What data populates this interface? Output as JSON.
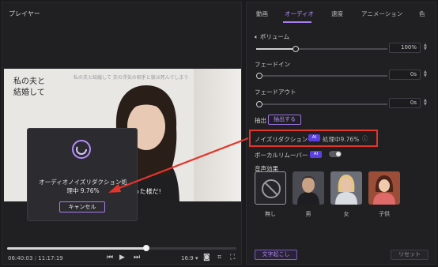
{
  "player": {
    "title": "プレイヤー",
    "video_title": "私の夫と\n結婚して",
    "video_subtitle": "私の夫と結婚して 夫の浮気の相手と彼は死んでしまう",
    "caption": "てしまった様だ!",
    "time_current": "06:40:03",
    "time_total": "11:17:19",
    "aspect": "16:9",
    "progress": 0.6
  },
  "dialog": {
    "message_line1": "オーディオノイズリダクション処",
    "message_line2": "理中 9.76%",
    "cancel_label": "キャンセル"
  },
  "panel": {
    "tabs": [
      {
        "label": "動画",
        "active": false
      },
      {
        "label": "オーディオ",
        "active": true
      },
      {
        "label": "速度",
        "active": false
      },
      {
        "label": "アニメーション",
        "active": false
      },
      {
        "label": "色",
        "active": false
      }
    ],
    "volume": {
      "label": "ボリューム",
      "value": "100%",
      "level": 0.3
    },
    "fade_in": {
      "label": "フェードイン",
      "value": "0s",
      "level": 0
    },
    "fade_out": {
      "label": "フェードアウト",
      "value": "0s",
      "level": 0
    },
    "extract": {
      "label": "抽出",
      "button": "抽出する"
    },
    "noise_reduction": {
      "label": "ノイズリダクション",
      "ai": "AI",
      "status": "処理中9.76%"
    },
    "vocal_remover": {
      "label": "ボーカルリムーバー",
      "ai": "AI"
    },
    "voice_effects": {
      "label": "音声効果",
      "items": [
        {
          "label": "無し"
        },
        {
          "label": "男"
        },
        {
          "label": "女"
        },
        {
          "label": "子供"
        }
      ]
    },
    "transcribe_label": "文字起こし",
    "reset_label": "リセット"
  },
  "colors": {
    "accent": "#a87df0",
    "highlight": "#e5342a"
  }
}
